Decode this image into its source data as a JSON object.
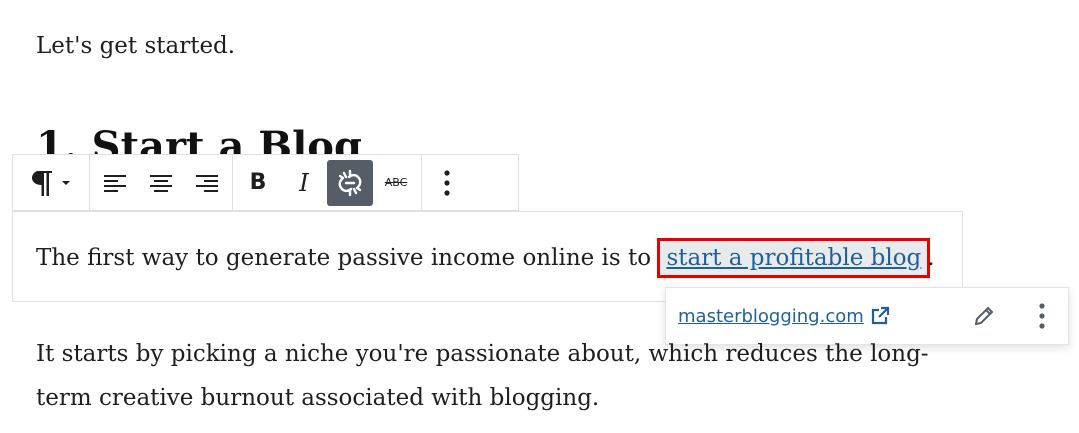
{
  "content": {
    "intro": "Let's get started.",
    "heading": "1. Start a Blog",
    "block_prefix": "The first way to generate passive income online is to ",
    "link_text": "start a profitable blog",
    "block_suffix": ".",
    "body_line1": "It starts by picking a niche you're passionate about, which reduces the long-",
    "body_line2": "term creative burnout associated with blogging."
  },
  "toolbar": {
    "paragraph_icon": "pilcrow-icon",
    "align_left_icon": "align-left-icon",
    "align_center_icon": "align-center-icon",
    "align_right_icon": "align-right-icon",
    "bold_label": "B",
    "italic_label": "I",
    "link_icon": "unlink-icon",
    "strikethrough_label": "ABC",
    "more_icon": "more-vertical-icon"
  },
  "popover": {
    "url": "masterblogging.com"
  },
  "colors": {
    "link": "#1f5f9a",
    "active_button_bg": "#555d66",
    "highlight_outline": "#e60000"
  }
}
